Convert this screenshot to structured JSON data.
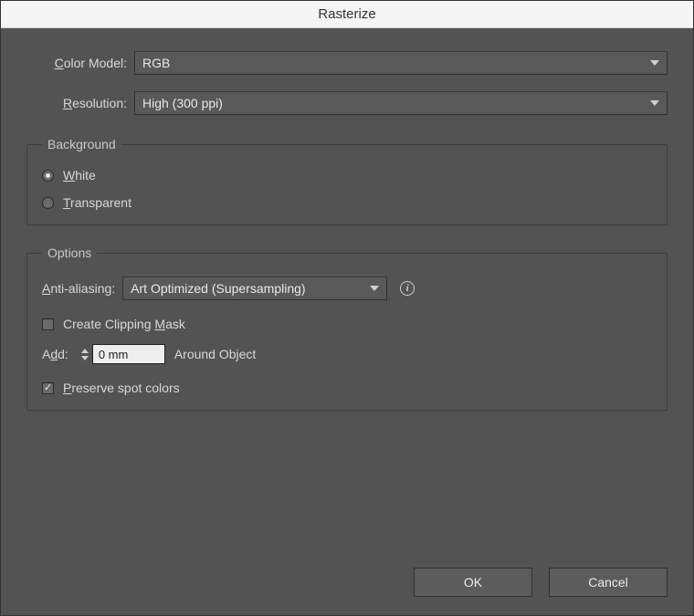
{
  "title": "Rasterize",
  "colorModel": {
    "label": "Color Model:",
    "value": "RGB"
  },
  "resolution": {
    "label": "Resolution:",
    "value": "High (300 ppi)"
  },
  "background": {
    "legend": "Background",
    "options": {
      "white": {
        "label": "White",
        "selected": true
      },
      "transparent": {
        "label": "Transparent",
        "selected": false
      }
    }
  },
  "options": {
    "legend": "Options",
    "antiAliasing": {
      "label": "Anti-aliasing:",
      "value": "Art Optimized (Supersampling)"
    },
    "clippingMask": {
      "label": "Create Clipping Mask",
      "checked": false
    },
    "add": {
      "label": "Add:",
      "value": "0 mm",
      "suffix": "Around Object"
    },
    "preserveSpot": {
      "label": "Preserve spot colors",
      "checked": true
    }
  },
  "buttons": {
    "ok": "OK",
    "cancel": "Cancel"
  }
}
